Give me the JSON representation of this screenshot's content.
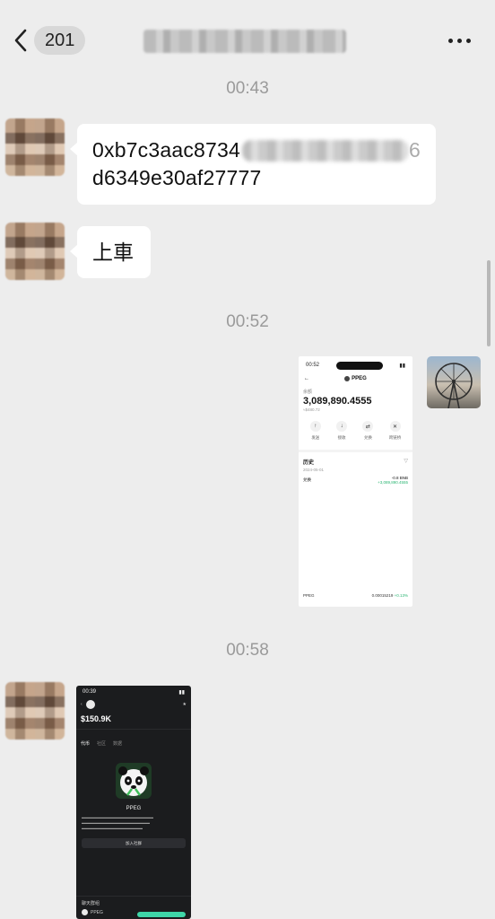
{
  "header": {
    "unread_count": "201",
    "colors": {
      "background": "#ededed",
      "badge": "#d8d8d8"
    }
  },
  "messages": [
    {
      "type": "timestamp",
      "text": "00:43"
    },
    {
      "type": "text",
      "side": "left",
      "line1": "0xb7c3aac8734",
      "line1_end": "6",
      "line2": "d6349e30af27777"
    },
    {
      "type": "text",
      "side": "left",
      "text": "上車"
    },
    {
      "type": "timestamp",
      "text": "00:52"
    },
    {
      "type": "image",
      "side": "right"
    },
    {
      "type": "timestamp",
      "text": "00:58"
    },
    {
      "type": "image",
      "side": "left"
    }
  ],
  "wallet_screenshot": {
    "time": "00:52",
    "token": "PPEG",
    "balance_label": "余额",
    "balance": "3,089,890.4555",
    "balance_sub": "≈$480.72",
    "actions": [
      "发送",
      "接收",
      "兑换",
      "跨链桥"
    ],
    "history_title": "历史",
    "history_date": "2024-05-01",
    "history_row": {
      "label": "兑换",
      "amount_out": "-0.8 BNB",
      "amount_in": "+3,089,890.4555"
    },
    "footer_token": "PPEG",
    "footer_value": "0.00015219",
    "footer_change": "+0.13%"
  },
  "token_screenshot": {
    "time": "00:39",
    "price": "$150.9K",
    "tabs": [
      "代币",
      "社区",
      "数据"
    ],
    "name": "PPEG",
    "button": "加入社群",
    "section": "聊天群组",
    "row_name": "PPEG"
  }
}
